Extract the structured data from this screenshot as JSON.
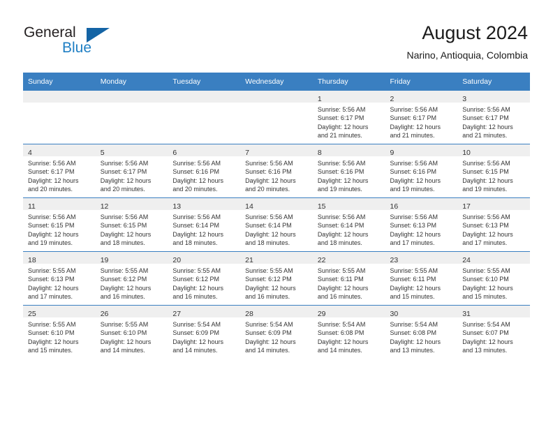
{
  "brand": {
    "name_top": "General",
    "name_bottom": "Blue",
    "accent_color": "#1464a5",
    "text_color": "#1f7fc4"
  },
  "header": {
    "title": "August 2024",
    "subtitle": "Narino, Antioquia, Colombia",
    "header_bg_color": "#3a7fc1"
  },
  "weekday_headers": [
    "Sunday",
    "Monday",
    "Tuesday",
    "Wednesday",
    "Thursday",
    "Friday",
    "Saturday"
  ],
  "weeks": [
    [
      {
        "day": "",
        "sunrise": "",
        "sunset": "",
        "daylight_line1": "",
        "daylight_line2": "",
        "empty": true
      },
      {
        "day": "",
        "sunrise": "",
        "sunset": "",
        "daylight_line1": "",
        "daylight_line2": "",
        "empty": true
      },
      {
        "day": "",
        "sunrise": "",
        "sunset": "",
        "daylight_line1": "",
        "daylight_line2": "",
        "empty": true
      },
      {
        "day": "",
        "sunrise": "",
        "sunset": "",
        "daylight_line1": "",
        "daylight_line2": "",
        "empty": true
      },
      {
        "day": "1",
        "sunrise": "Sunrise: 5:56 AM",
        "sunset": "Sunset: 6:17 PM",
        "daylight_line1": "Daylight: 12 hours",
        "daylight_line2": "and 21 minutes.",
        "empty": false
      },
      {
        "day": "2",
        "sunrise": "Sunrise: 5:56 AM",
        "sunset": "Sunset: 6:17 PM",
        "daylight_line1": "Daylight: 12 hours",
        "daylight_line2": "and 21 minutes.",
        "empty": false
      },
      {
        "day": "3",
        "sunrise": "Sunrise: 5:56 AM",
        "sunset": "Sunset: 6:17 PM",
        "daylight_line1": "Daylight: 12 hours",
        "daylight_line2": "and 21 minutes.",
        "empty": false
      }
    ],
    [
      {
        "day": "4",
        "sunrise": "Sunrise: 5:56 AM",
        "sunset": "Sunset: 6:17 PM",
        "daylight_line1": "Daylight: 12 hours",
        "daylight_line2": "and 20 minutes.",
        "empty": false
      },
      {
        "day": "5",
        "sunrise": "Sunrise: 5:56 AM",
        "sunset": "Sunset: 6:17 PM",
        "daylight_line1": "Daylight: 12 hours",
        "daylight_line2": "and 20 minutes.",
        "empty": false
      },
      {
        "day": "6",
        "sunrise": "Sunrise: 5:56 AM",
        "sunset": "Sunset: 6:16 PM",
        "daylight_line1": "Daylight: 12 hours",
        "daylight_line2": "and 20 minutes.",
        "empty": false
      },
      {
        "day": "7",
        "sunrise": "Sunrise: 5:56 AM",
        "sunset": "Sunset: 6:16 PM",
        "daylight_line1": "Daylight: 12 hours",
        "daylight_line2": "and 20 minutes.",
        "empty": false
      },
      {
        "day": "8",
        "sunrise": "Sunrise: 5:56 AM",
        "sunset": "Sunset: 6:16 PM",
        "daylight_line1": "Daylight: 12 hours",
        "daylight_line2": "and 19 minutes.",
        "empty": false
      },
      {
        "day": "9",
        "sunrise": "Sunrise: 5:56 AM",
        "sunset": "Sunset: 6:16 PM",
        "daylight_line1": "Daylight: 12 hours",
        "daylight_line2": "and 19 minutes.",
        "empty": false
      },
      {
        "day": "10",
        "sunrise": "Sunrise: 5:56 AM",
        "sunset": "Sunset: 6:15 PM",
        "daylight_line1": "Daylight: 12 hours",
        "daylight_line2": "and 19 minutes.",
        "empty": false
      }
    ],
    [
      {
        "day": "11",
        "sunrise": "Sunrise: 5:56 AM",
        "sunset": "Sunset: 6:15 PM",
        "daylight_line1": "Daylight: 12 hours",
        "daylight_line2": "and 19 minutes.",
        "empty": false
      },
      {
        "day": "12",
        "sunrise": "Sunrise: 5:56 AM",
        "sunset": "Sunset: 6:15 PM",
        "daylight_line1": "Daylight: 12 hours",
        "daylight_line2": "and 18 minutes.",
        "empty": false
      },
      {
        "day": "13",
        "sunrise": "Sunrise: 5:56 AM",
        "sunset": "Sunset: 6:14 PM",
        "daylight_line1": "Daylight: 12 hours",
        "daylight_line2": "and 18 minutes.",
        "empty": false
      },
      {
        "day": "14",
        "sunrise": "Sunrise: 5:56 AM",
        "sunset": "Sunset: 6:14 PM",
        "daylight_line1": "Daylight: 12 hours",
        "daylight_line2": "and 18 minutes.",
        "empty": false
      },
      {
        "day": "15",
        "sunrise": "Sunrise: 5:56 AM",
        "sunset": "Sunset: 6:14 PM",
        "daylight_line1": "Daylight: 12 hours",
        "daylight_line2": "and 18 minutes.",
        "empty": false
      },
      {
        "day": "16",
        "sunrise": "Sunrise: 5:56 AM",
        "sunset": "Sunset: 6:13 PM",
        "daylight_line1": "Daylight: 12 hours",
        "daylight_line2": "and 17 minutes.",
        "empty": false
      },
      {
        "day": "17",
        "sunrise": "Sunrise: 5:56 AM",
        "sunset": "Sunset: 6:13 PM",
        "daylight_line1": "Daylight: 12 hours",
        "daylight_line2": "and 17 minutes.",
        "empty": false
      }
    ],
    [
      {
        "day": "18",
        "sunrise": "Sunrise: 5:55 AM",
        "sunset": "Sunset: 6:13 PM",
        "daylight_line1": "Daylight: 12 hours",
        "daylight_line2": "and 17 minutes.",
        "empty": false
      },
      {
        "day": "19",
        "sunrise": "Sunrise: 5:55 AM",
        "sunset": "Sunset: 6:12 PM",
        "daylight_line1": "Daylight: 12 hours",
        "daylight_line2": "and 16 minutes.",
        "empty": false
      },
      {
        "day": "20",
        "sunrise": "Sunrise: 5:55 AM",
        "sunset": "Sunset: 6:12 PM",
        "daylight_line1": "Daylight: 12 hours",
        "daylight_line2": "and 16 minutes.",
        "empty": false
      },
      {
        "day": "21",
        "sunrise": "Sunrise: 5:55 AM",
        "sunset": "Sunset: 6:12 PM",
        "daylight_line1": "Daylight: 12 hours",
        "daylight_line2": "and 16 minutes.",
        "empty": false
      },
      {
        "day": "22",
        "sunrise": "Sunrise: 5:55 AM",
        "sunset": "Sunset: 6:11 PM",
        "daylight_line1": "Daylight: 12 hours",
        "daylight_line2": "and 16 minutes.",
        "empty": false
      },
      {
        "day": "23",
        "sunrise": "Sunrise: 5:55 AM",
        "sunset": "Sunset: 6:11 PM",
        "daylight_line1": "Daylight: 12 hours",
        "daylight_line2": "and 15 minutes.",
        "empty": false
      },
      {
        "day": "24",
        "sunrise": "Sunrise: 5:55 AM",
        "sunset": "Sunset: 6:10 PM",
        "daylight_line1": "Daylight: 12 hours",
        "daylight_line2": "and 15 minutes.",
        "empty": false
      }
    ],
    [
      {
        "day": "25",
        "sunrise": "Sunrise: 5:55 AM",
        "sunset": "Sunset: 6:10 PM",
        "daylight_line1": "Daylight: 12 hours",
        "daylight_line2": "and 15 minutes.",
        "empty": false
      },
      {
        "day": "26",
        "sunrise": "Sunrise: 5:55 AM",
        "sunset": "Sunset: 6:10 PM",
        "daylight_line1": "Daylight: 12 hours",
        "daylight_line2": "and 14 minutes.",
        "empty": false
      },
      {
        "day": "27",
        "sunrise": "Sunrise: 5:54 AM",
        "sunset": "Sunset: 6:09 PM",
        "daylight_line1": "Daylight: 12 hours",
        "daylight_line2": "and 14 minutes.",
        "empty": false
      },
      {
        "day": "28",
        "sunrise": "Sunrise: 5:54 AM",
        "sunset": "Sunset: 6:09 PM",
        "daylight_line1": "Daylight: 12 hours",
        "daylight_line2": "and 14 minutes.",
        "empty": false
      },
      {
        "day": "29",
        "sunrise": "Sunrise: 5:54 AM",
        "sunset": "Sunset: 6:08 PM",
        "daylight_line1": "Daylight: 12 hours",
        "daylight_line2": "and 14 minutes.",
        "empty": false
      },
      {
        "day": "30",
        "sunrise": "Sunrise: 5:54 AM",
        "sunset": "Sunset: 6:08 PM",
        "daylight_line1": "Daylight: 12 hours",
        "daylight_line2": "and 13 minutes.",
        "empty": false
      },
      {
        "day": "31",
        "sunrise": "Sunrise: 5:54 AM",
        "sunset": "Sunset: 6:07 PM",
        "daylight_line1": "Daylight: 12 hours",
        "daylight_line2": "and 13 minutes.",
        "empty": false
      }
    ]
  ]
}
